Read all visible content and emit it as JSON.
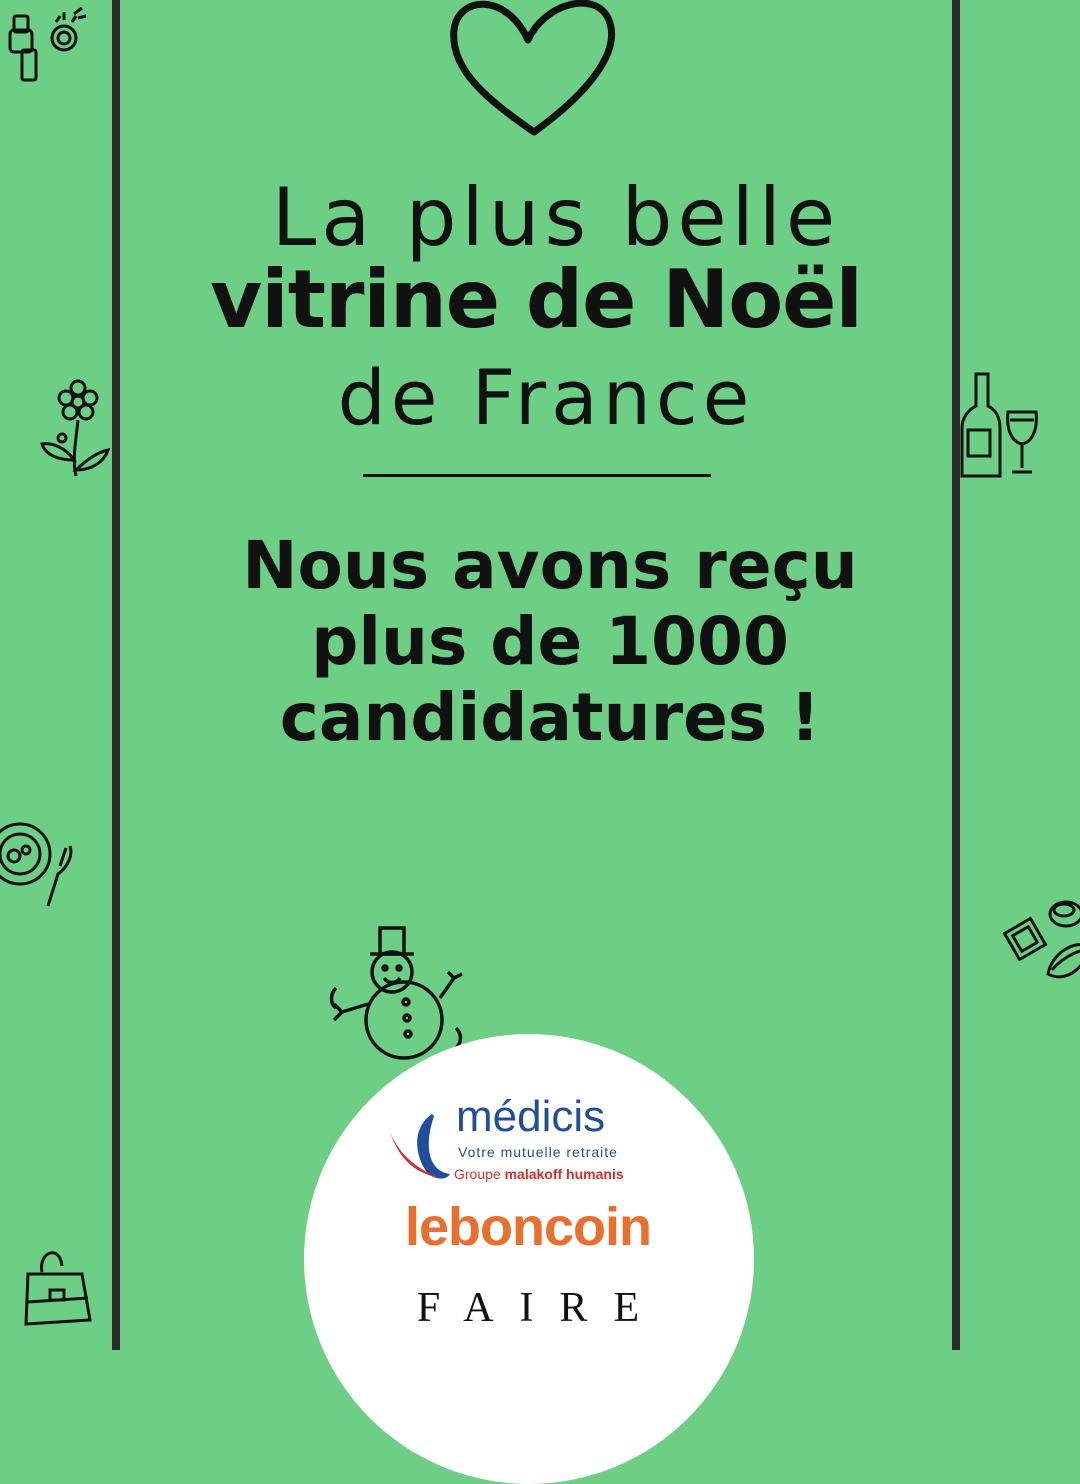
{
  "background_color": "#6ccf85",
  "accent_color": "#111111",
  "title": {
    "line1": "La plus belle",
    "line2": "vitrine de Noël",
    "line3": "de France"
  },
  "headline": {
    "line1": "Nous avons reçu",
    "line2": "plus de 1000",
    "line3": "candidatures !"
  },
  "icons": {
    "top": "heart-icon",
    "left_top": "watch-ring-icon",
    "left_mid": "flower-icon",
    "left_lower": "plate-fork-icon",
    "left_bottom": "handbag-icon",
    "right_mid": "wine-bottle-glass-icon",
    "right_lower": "chocolates-icon",
    "center_bottom": "snowman-icon"
  },
  "sponsors": {
    "medicis": {
      "name": "médicis",
      "tagline": "Votre mutuelle retraite",
      "group_prefix": "Groupe ",
      "group_name": "malakoff humanis",
      "color": "#1f4f9c",
      "accent": "#d3302b"
    },
    "leboncoin": {
      "name": "leboncoin",
      "color": "#ec6e2c"
    },
    "faire": {
      "name": "FAIRE"
    }
  }
}
